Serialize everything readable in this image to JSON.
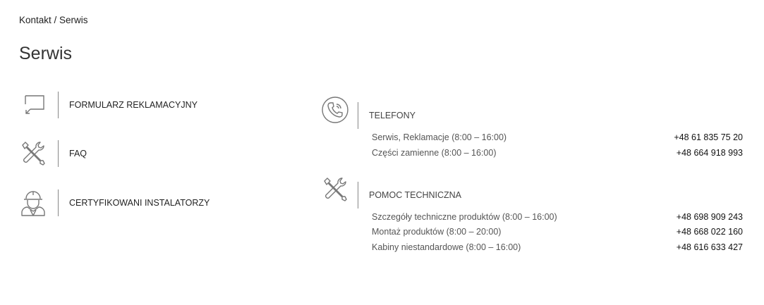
{
  "breadcrumb": {
    "home": "Kontakt",
    "separator": " / ",
    "current": "Serwis"
  },
  "page_title": "Serwis",
  "left_links": [
    {
      "label": "FORMULARZ REKLAMACYJNY",
      "icon": "reply-icon"
    },
    {
      "label": "FAQ",
      "icon": "tools-icon"
    },
    {
      "label": "CERTYFIKOWANI INSTALATORZY",
      "icon": "installer-icon"
    }
  ],
  "sections": [
    {
      "title": "TELEFONY",
      "icon": "phone-icon",
      "rows": [
        {
          "desc": "Serwis, Reklamacje (8:00 – 16:00)",
          "phone": "+48 61 835 75 20"
        },
        {
          "desc": "Części zamienne (8:00 – 16:00)",
          "phone": "+48 664 918 993"
        }
      ]
    },
    {
      "title": "POMOC TECHNICZNA",
      "icon": "tools-icon",
      "rows": [
        {
          "desc": "Szczegóły techniczne produktów (8:00 – 16:00)",
          "phone": "+48 698 909 243"
        },
        {
          "desc": "Montaż produktów (8:00 – 20:00)",
          "phone": "+48 668 022 160"
        },
        {
          "desc": "Kabiny niestandardowe (8:00 – 16:00)",
          "phone": "+48 616 633 427"
        }
      ]
    }
  ]
}
